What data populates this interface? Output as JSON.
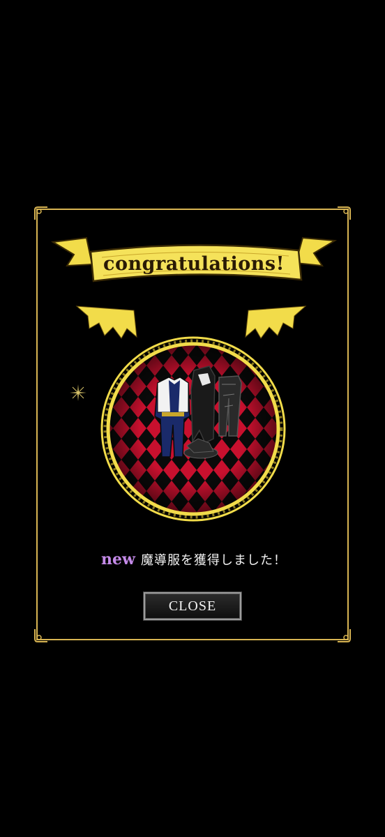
{
  "reward_dialog": {
    "title": "congratulations!",
    "new_badge": "new",
    "message": "魔導服を獲得しました！",
    "close_label": "CLOSE"
  },
  "colors": {
    "frame_gold": "#d9b553",
    "banner_yellow": "#f2dc4a",
    "medallion_red": "#c8102e",
    "new_badge_purple": "#c48ae8"
  },
  "icons": [
    "ornate-corner-icon",
    "bat-wing-icon",
    "sparkle-icon",
    "outfit-reward-icon"
  ]
}
